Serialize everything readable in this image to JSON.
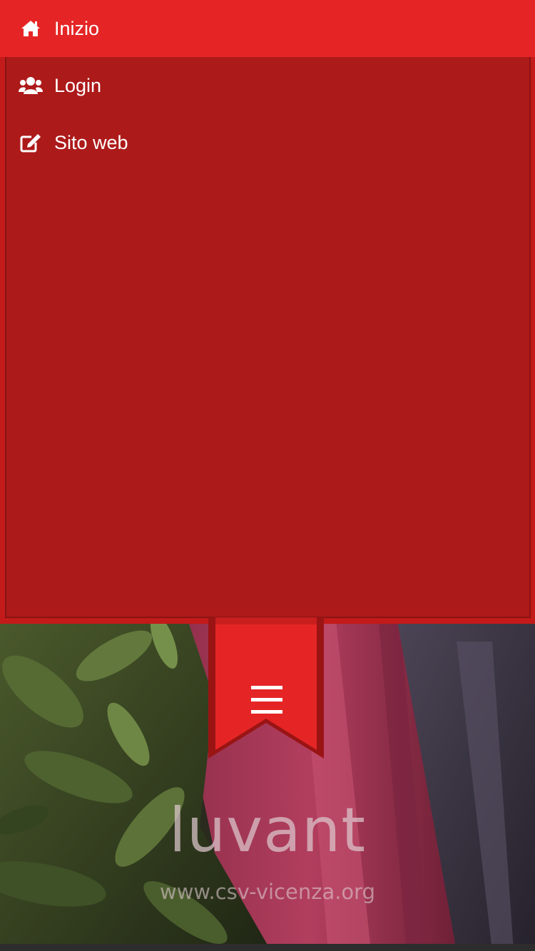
{
  "menu": {
    "items": [
      {
        "label": "Inizio",
        "icon": "home-icon",
        "active": true
      },
      {
        "label": "Login",
        "icon": "users-icon",
        "active": false
      },
      {
        "label": "Sito web",
        "icon": "edit-icon",
        "active": false
      }
    ]
  },
  "toggle": {
    "icon": "hamburger-icon"
  },
  "hero": {
    "title": "luvant",
    "url": "www.csv-vicenza.org"
  },
  "colors": {
    "active": "#e52525",
    "panel": "#ad1a1a",
    "ribbon": "#e52525"
  }
}
